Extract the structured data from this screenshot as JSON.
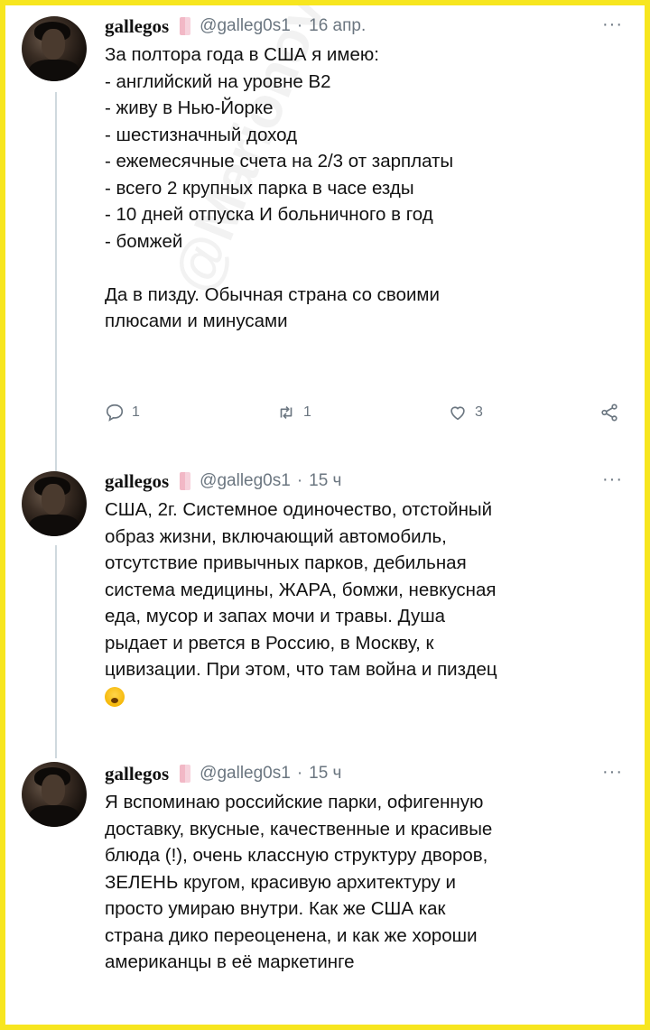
{
  "tweets": [
    {
      "name": "gallegos",
      "handle": "@galleg0s1",
      "separator": "·",
      "date": "16 апр.",
      "more": "···",
      "lines": [
        "За полтора года в США я имею:",
        "- английский на уровне B2",
        "- живу в Нью-Йорке",
        "- шестизначный доход",
        "- ежемесячные счета на 2/3 от зарплаты",
        "- всего 2 крупных парка в часе езды",
        "- 10 дней отпуска И больничного в год",
        "- бомжей",
        "",
        "Да в пизду. Обычная страна со своими",
        "плюсами и минусами"
      ],
      "actions": {
        "reply_count": "1",
        "retweet_count": "1",
        "like_count": "3"
      }
    },
    {
      "name": "gallegos",
      "handle": "@galleg0s1",
      "separator": "·",
      "date": "15 ч",
      "more": "···",
      "lines": [
        "США, 2г. Системное одиночество, отстойный",
        "образ жизни, включающий автомобиль,",
        "отсутствие привычных парков, дебильная",
        "система медицины,  ЖАРА, бомжи, невкусная",
        "еда, мусор и запах мочи и травы. Душа",
        "рыдает и рвется в Россию, в Москву, к",
        "цивизации. При этом, что там война и пиздец"
      ],
      "emoji": "crying-face"
    },
    {
      "name": "gallegos",
      "handle": "@galleg0s1",
      "separator": "·",
      "date": "15 ч",
      "more": "···",
      "lines": [
        "Я вспоминаю российские парки, офигенную",
        "доставку, вкусные, качественные и красивые",
        "блюда (!), очень классную структуру дворов,",
        "ЗЕЛЕНЬ кругом, красивую архитектуру и",
        "просто умираю внутри. Как же США как",
        "страна дико переоценена, и как же хороши",
        "американцы в её маркетинге"
      ]
    }
  ],
  "watermark": "@MarionovaliazBratka",
  "colors": {
    "border": "#f7e61f",
    "text": "#121212",
    "muted": "#6b7680",
    "thread_line": "#cfd9de"
  }
}
